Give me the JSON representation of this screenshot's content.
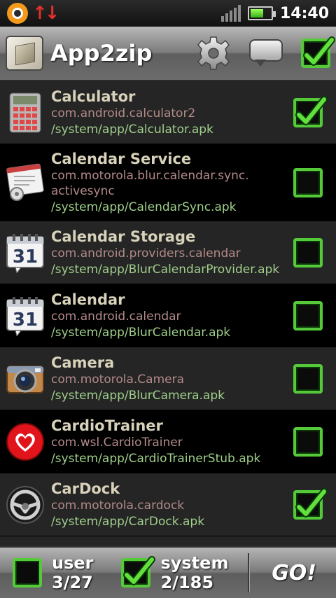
{
  "status_bar": {
    "time": "14:40",
    "icons": [
      "sync-notification-icon",
      "data-transfer-icon",
      "signal-icon",
      "battery-icon"
    ]
  },
  "header": {
    "title": "App2zip",
    "actions": [
      "gear-icon",
      "chat-icon",
      "select-all-checkbox"
    ],
    "select_all_checked": true
  },
  "apps": [
    {
      "name": "Calculator",
      "package": "com.android.calculator2",
      "path": "/system/app/Calculator.apk",
      "checked": true,
      "icon": "calculator-icon"
    },
    {
      "name": "Calendar Service",
      "package": "com.motorola.blur.calendar.sync.activesync",
      "package_line1": "com.motorola.blur.calendar.sync.",
      "package_line2": "activesync",
      "path": "/system/app/CalendarSync.apk",
      "checked": false,
      "icon": "settings-window-icon"
    },
    {
      "name": "Calendar Storage",
      "package": "com.android.providers.calendar",
      "path": "/system/app/BlurCalendarProvider.apk",
      "checked": false,
      "icon": "calendar-icon"
    },
    {
      "name": "Calendar",
      "package": "com.android.calendar",
      "path": "/system/app/BlurCalendar.apk",
      "checked": false,
      "icon": "calendar-icon"
    },
    {
      "name": "Camera",
      "package": "com.motorola.Camera",
      "path": "/system/app/BlurCamera.apk",
      "checked": false,
      "icon": "camera-icon"
    },
    {
      "name": "CardioTrainer",
      "package": "com.wsl.CardioTrainer",
      "path": "/system/app/CardioTrainerStub.apk",
      "checked": false,
      "icon": "heart-icon"
    },
    {
      "name": "CarDock",
      "package": "com.motorola.cardock",
      "path": "/system/app/CarDock.apk",
      "checked": true,
      "icon": "steering-wheel-icon"
    }
  ],
  "calendar_day": "31",
  "footer": {
    "user_label": "user",
    "user_count": "3/27",
    "user_checked": false,
    "system_label": "system",
    "system_count": "2/185",
    "system_checked": true,
    "go_label": "GO!"
  },
  "colors": {
    "accent_green": "#56c93a",
    "app_name": "#d8d2ba",
    "package_text": "#b48a8a",
    "path_text": "#9fcf8a",
    "row_dark": "#252525",
    "row_black": "#000000"
  }
}
